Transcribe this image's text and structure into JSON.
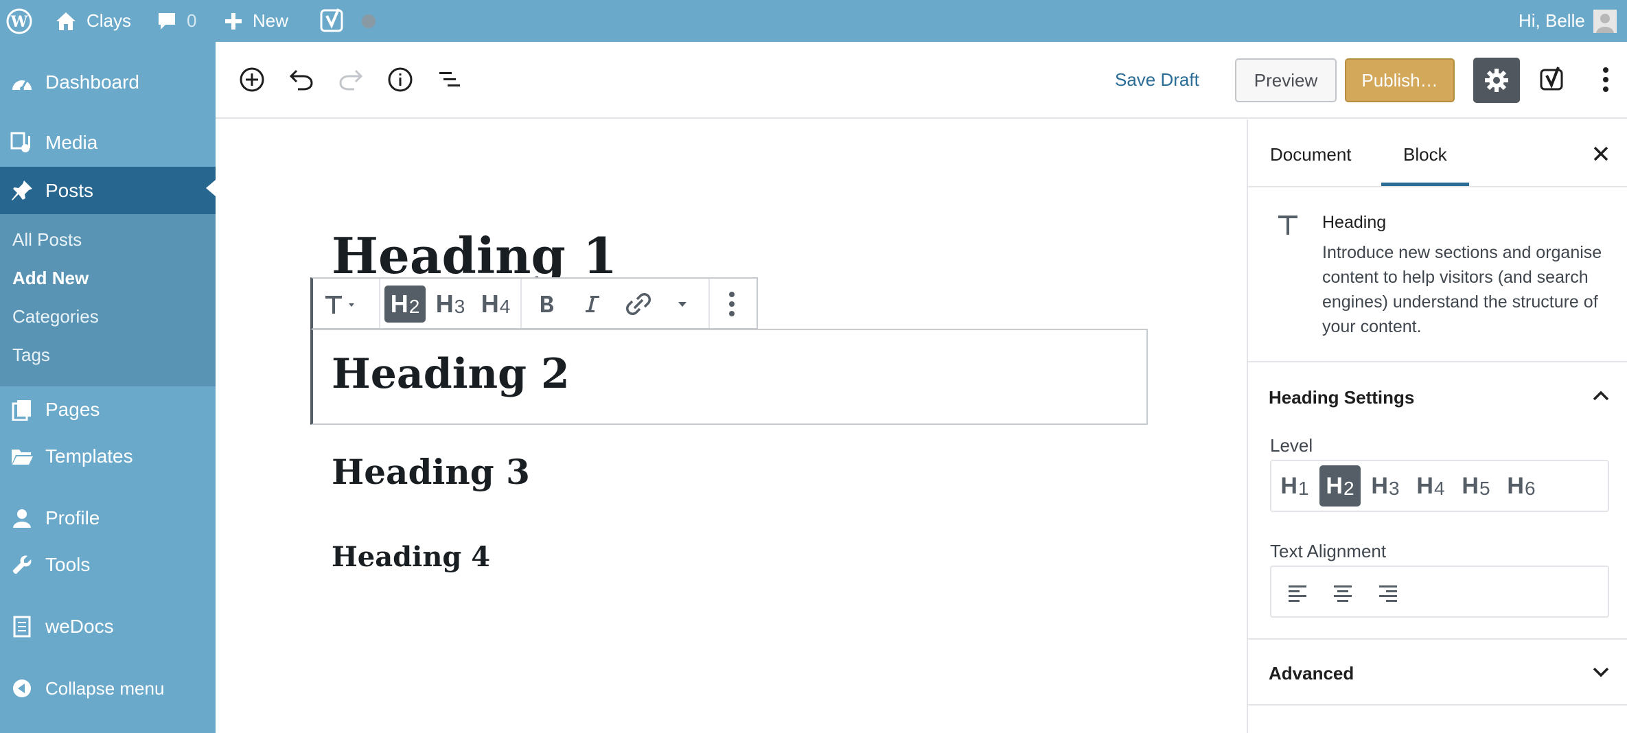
{
  "admin_bar": {
    "site_name": "Clays",
    "comment_count": "0",
    "new_label": "New",
    "greeting": "Hi, Belle"
  },
  "sidebar": {
    "items": [
      {
        "label": "Dashboard",
        "icon": "dashboard-icon"
      },
      {
        "label": "Media",
        "icon": "media-icon"
      },
      {
        "label": "Posts",
        "icon": "pin-icon"
      },
      {
        "label": "Pages",
        "icon": "pages-icon"
      },
      {
        "label": "Templates",
        "icon": "folder-icon"
      },
      {
        "label": "Profile",
        "icon": "user-icon"
      },
      {
        "label": "Tools",
        "icon": "wrench-icon"
      },
      {
        "label": "weDocs",
        "icon": "document-icon"
      },
      {
        "label": "Collapse menu",
        "icon": "collapse-icon"
      }
    ],
    "submenu": [
      "All Posts",
      "Add New",
      "Categories",
      "Tags"
    ]
  },
  "editor_header": {
    "save_draft": "Save Draft",
    "preview": "Preview",
    "publish": "Publish…"
  },
  "content": {
    "h1": "Heading 1",
    "h2": "Heading 2",
    "h3": "Heading 3",
    "h4": "Heading 4"
  },
  "toolbar": {
    "heading_levels": [
      {
        "label": "H",
        "num": "2"
      },
      {
        "label": "H",
        "num": "3"
      },
      {
        "label": "H",
        "num": "4"
      }
    ]
  },
  "settings_panel": {
    "tabs": [
      "Document",
      "Block"
    ],
    "block_name": "Heading",
    "block_description": "Introduce new sections and organise content to help visitors (and search engines) understand the structure of your content.",
    "heading_settings_title": "Heading Settings",
    "level_label": "Level",
    "levels": [
      {
        "label": "H",
        "num": "1"
      },
      {
        "label": "H",
        "num": "2"
      },
      {
        "label": "H",
        "num": "3"
      },
      {
        "label": "H",
        "num": "4"
      },
      {
        "label": "H",
        "num": "5"
      },
      {
        "label": "H",
        "num": "6"
      }
    ],
    "text_alignment_label": "Text Alignment",
    "advanced_title": "Advanced"
  },
  "colors": {
    "admin_blue": "#6aa9c9",
    "active_menu": "#27668f",
    "publish": "#d3a85a",
    "selected_dark": "#555d66"
  }
}
